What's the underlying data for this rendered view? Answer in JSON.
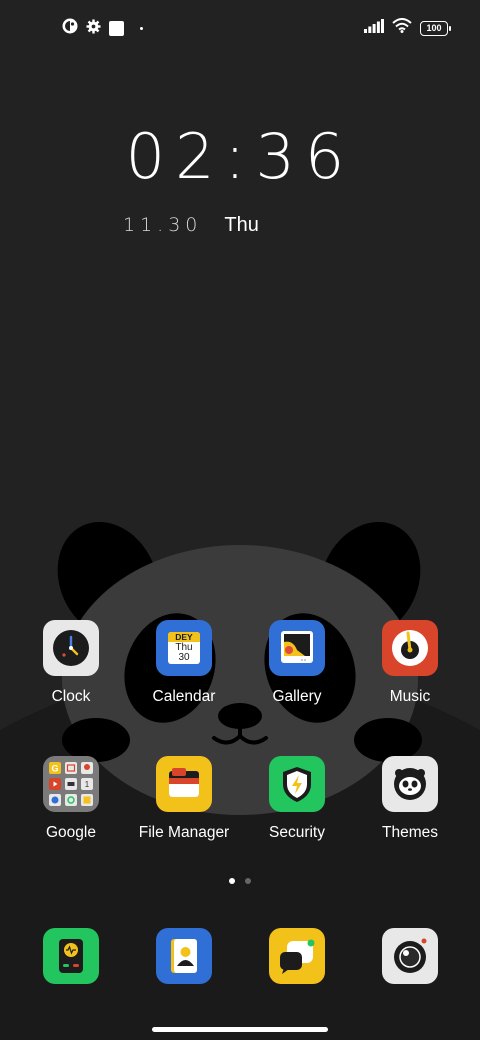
{
  "status_bar": {
    "left_icons": [
      "notification-app-icon",
      "settings-gear-icon",
      "square-notification-icon",
      "dot-icon"
    ],
    "right_icons": [
      "cellular-signal-icon",
      "wifi-icon"
    ],
    "battery_level": "100"
  },
  "clock": {
    "time": "02:36",
    "date": "11.30",
    "weekday": "Thu"
  },
  "apps_row1": [
    {
      "label": "Clock",
      "icon": "clock-icon"
    },
    {
      "label": "Calendar",
      "icon": "calendar-icon",
      "cal_header": "DEY",
      "cal_day": "Thu",
      "cal_date": "30"
    },
    {
      "label": "Gallery",
      "icon": "gallery-icon"
    },
    {
      "label": "Music",
      "icon": "music-icon"
    }
  ],
  "apps_row2": [
    {
      "label": "Google",
      "icon": "google-folder-icon"
    },
    {
      "label": "File Manager",
      "icon": "file-manager-icon"
    },
    {
      "label": "Security",
      "icon": "security-icon"
    },
    {
      "label": "Themes",
      "icon": "themes-icon"
    }
  ],
  "dock": [
    {
      "icon": "phone-icon"
    },
    {
      "icon": "contacts-icon"
    },
    {
      "icon": "messages-icon"
    },
    {
      "icon": "camera-icon"
    }
  ],
  "page_indicator": {
    "pages": 2,
    "current": 1
  },
  "colors": {
    "background": "#1f1f1f",
    "panda_face": "#3b3b3b",
    "panda_black": "#000000",
    "green": "#22c55e",
    "blue": "#2f6fd6",
    "yellow": "#f2c21b",
    "red": "#d9452b"
  }
}
